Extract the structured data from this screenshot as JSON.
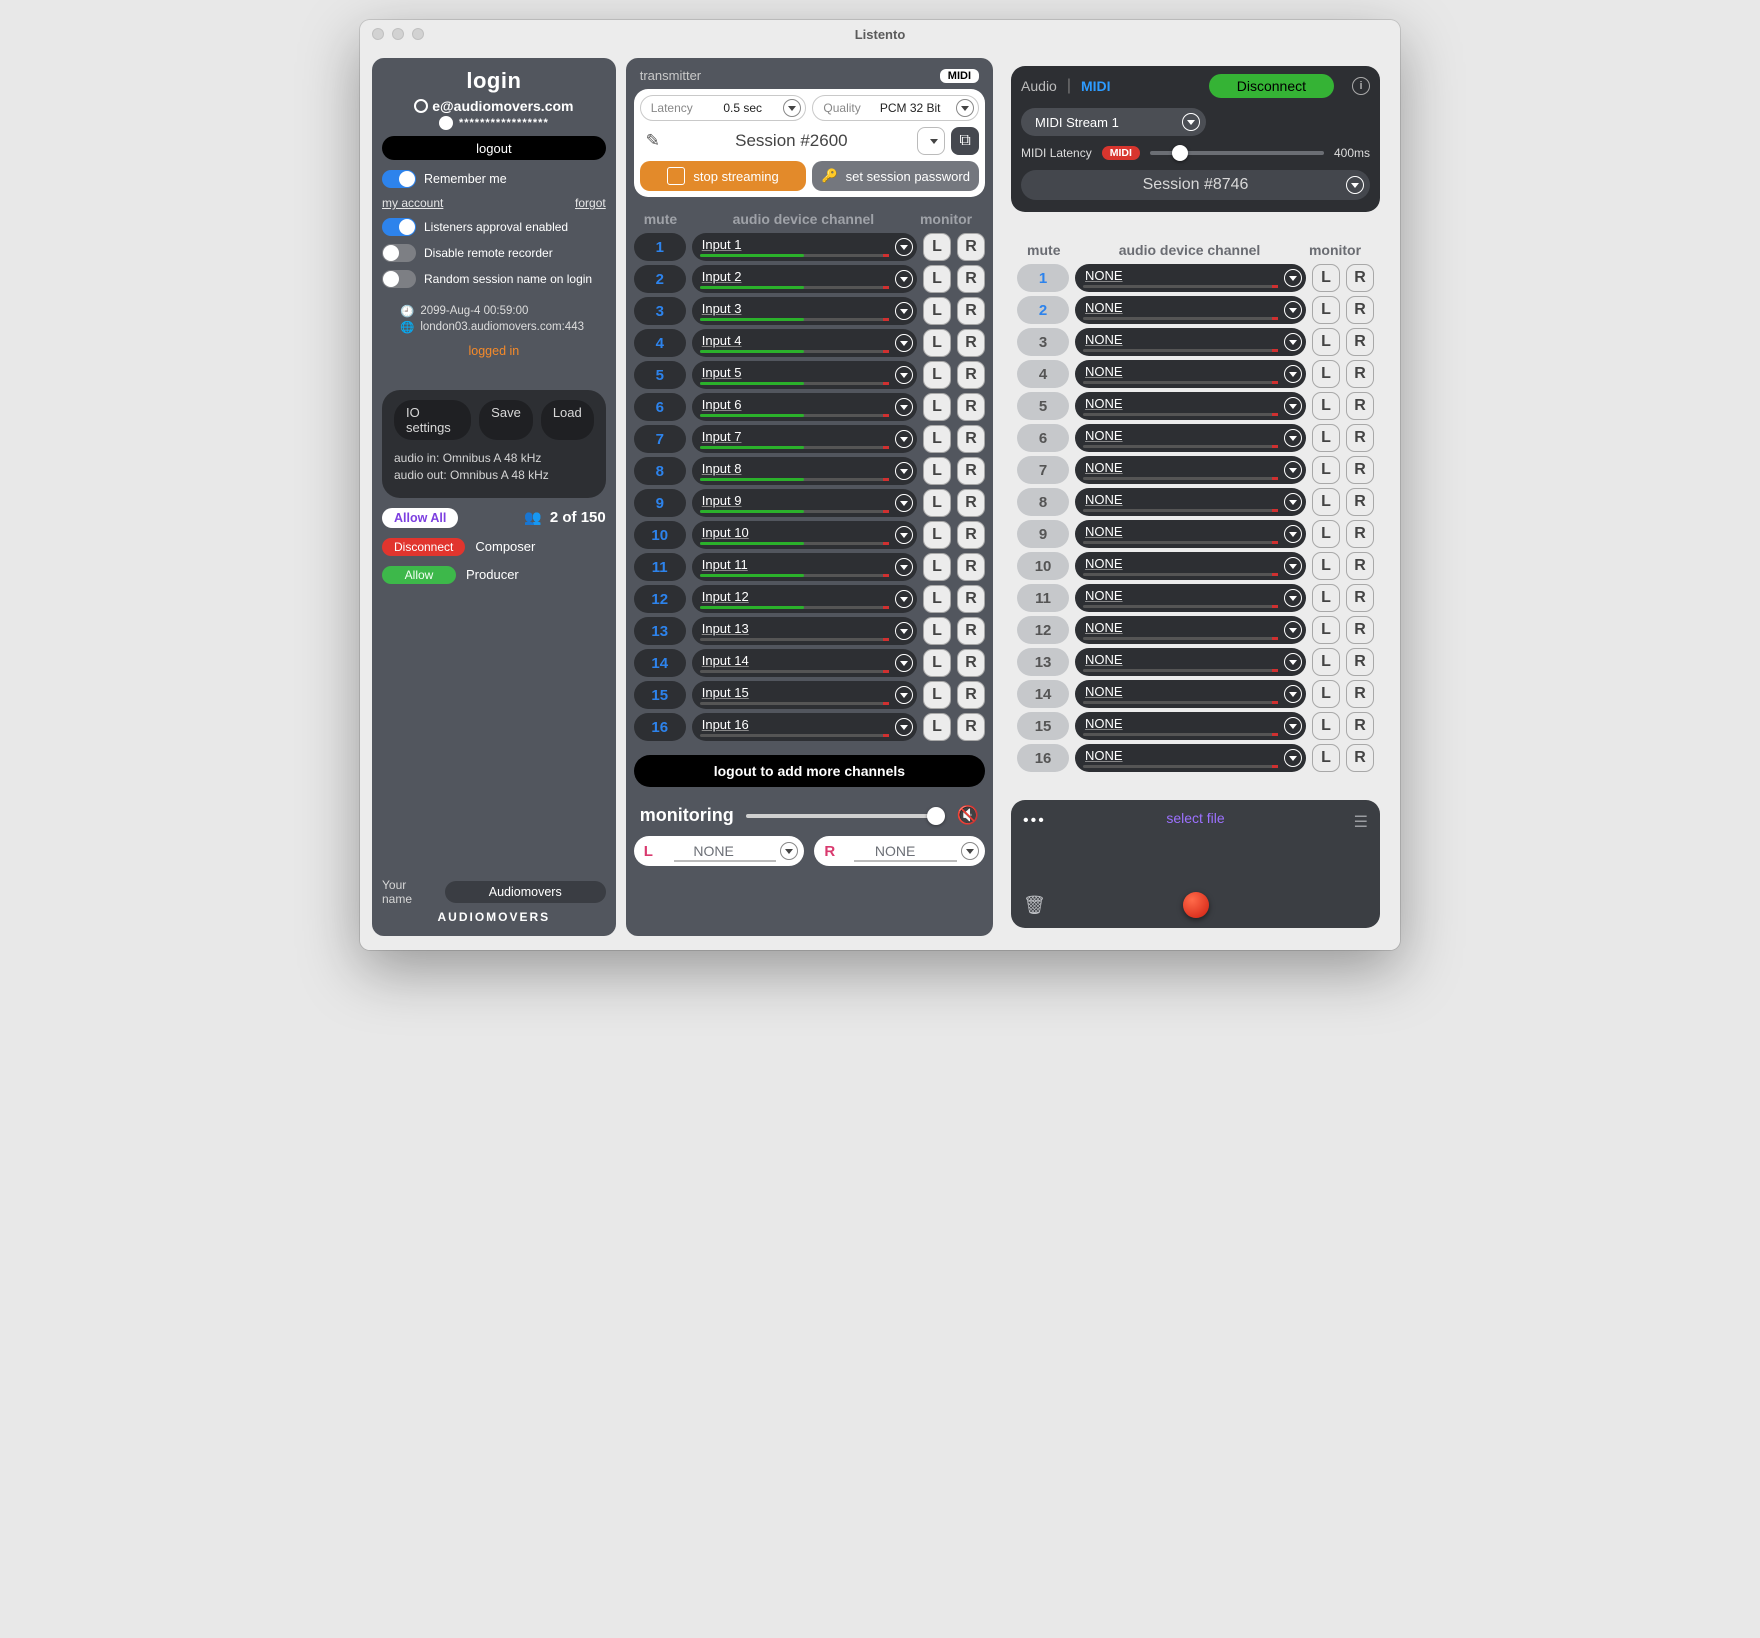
{
  "titlebar": {
    "title": "Listento"
  },
  "left": {
    "login_title": "login",
    "email": "e@audiomovers.com",
    "password_mask": "*****************",
    "logout": "logout",
    "remember": "Remember me",
    "my_account": "my account",
    "forgot": "forgot",
    "approval": "Listeners approval enabled",
    "disable_rec": "Disable remote recorder",
    "random_name": "Random session name on login",
    "clock": "2099-Aug-4 00:59:00",
    "server": "london03.audiomovers.com:443",
    "status": "logged in",
    "io_settings": "IO settings",
    "save": "Save",
    "load": "Load",
    "audio_in": "audio in: Omnibus A 48 kHz",
    "audio_out": "audio out: Omnibus A 48 kHz",
    "allow_all": "Allow All",
    "listeners_count": "2 of 150",
    "listener_1": {
      "action": "Disconnect",
      "name": "Composer"
    },
    "listener_2": {
      "action": "Allow",
      "name": "Producer"
    },
    "your_name_label": "Your name",
    "your_name_value": "Audiomovers",
    "brand": "AUDIOMOVERS"
  },
  "mid": {
    "header": "transmitter",
    "midi_badge": "MIDI",
    "latency_label": "Latency",
    "latency_value": "0.5 sec",
    "quality_label": "Quality",
    "quality_value": "PCM 32 Bit",
    "session_name": "Session #2600",
    "stop_stream": "stop streaming",
    "set_pw": "set session password",
    "cols": {
      "mute": "mute",
      "device": "audio device channel",
      "monitor": "monitor"
    },
    "channels": [
      {
        "n": "1",
        "dev": "Input 1",
        "lvl": 55
      },
      {
        "n": "2",
        "dev": "Input 2",
        "lvl": 55
      },
      {
        "n": "3",
        "dev": "Input 3",
        "lvl": 55
      },
      {
        "n": "4",
        "dev": "Input 4",
        "lvl": 55
      },
      {
        "n": "5",
        "dev": "Input 5",
        "lvl": 55
      },
      {
        "n": "6",
        "dev": "Input 6",
        "lvl": 55
      },
      {
        "n": "7",
        "dev": "Input 7",
        "lvl": 55
      },
      {
        "n": "8",
        "dev": "Input 8",
        "lvl": 55
      },
      {
        "n": "9",
        "dev": "Input 9",
        "lvl": 55
      },
      {
        "n": "10",
        "dev": "Input 10",
        "lvl": 55
      },
      {
        "n": "11",
        "dev": "Input 11",
        "lvl": 55
      },
      {
        "n": "12",
        "dev": "Input 12",
        "lvl": 55
      },
      {
        "n": "13",
        "dev": "Input 13",
        "lvl": 0
      },
      {
        "n": "14",
        "dev": "Input 14",
        "lvl": 0
      },
      {
        "n": "15",
        "dev": "Input 15",
        "lvl": 0
      },
      {
        "n": "16",
        "dev": "Input 16",
        "lvl": 0
      }
    ],
    "add_more": "logout to add more channels",
    "monitoring_title": "monitoring",
    "mon_L": "NONE",
    "mon_R": "NONE"
  },
  "right": {
    "tab_audio": "Audio",
    "tab_midi": "MIDI",
    "connect": "Disconnect",
    "stream": "MIDI Stream 1",
    "latency_label": "MIDI Latency",
    "latency_badge": "MIDI",
    "latency_value": "400ms",
    "session": "Session #8746",
    "cols": {
      "mute": "mute",
      "device": "audio device channel",
      "monitor": "monitor"
    },
    "channels": [
      {
        "n": "1"
      },
      {
        "n": "2"
      },
      {
        "n": "3"
      },
      {
        "n": "4"
      },
      {
        "n": "5"
      },
      {
        "n": "6"
      },
      {
        "n": "7"
      },
      {
        "n": "8"
      },
      {
        "n": "9"
      },
      {
        "n": "10"
      },
      {
        "n": "11"
      },
      {
        "n": "12"
      },
      {
        "n": "13"
      },
      {
        "n": "14"
      },
      {
        "n": "15"
      },
      {
        "n": "16"
      }
    ],
    "dev_none": "NONE",
    "select_file": "select file"
  }
}
